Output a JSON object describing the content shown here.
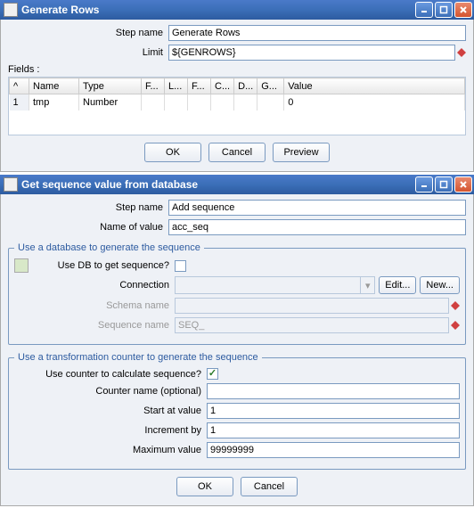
{
  "window1": {
    "title": "Generate Rows",
    "step_name_label": "Step name",
    "step_name_value": "Generate Rows",
    "limit_label": "Limit",
    "limit_value": "${GENROWS}",
    "fields_label": "Fields :",
    "columns": {
      "idx": "^",
      "name": "Name",
      "type": "Type",
      "f": "F...",
      "l": "L...",
      "fmt": "F...",
      "c": "C...",
      "d": "D...",
      "g": "G...",
      "value": "Value"
    },
    "row": {
      "idx": "1",
      "name": "tmp",
      "type": "Number",
      "value": "0"
    },
    "ok": "OK",
    "cancel": "Cancel",
    "preview": "Preview"
  },
  "window2": {
    "title": "Get sequence value from database",
    "step_name_label": "Step name",
    "step_name_value": "Add sequence",
    "name_of_value_label": "Name of value",
    "name_of_value_value": "acc_seq",
    "fs1_legend": "Use a database to generate the sequence",
    "use_db_label": "Use DB to get sequence?",
    "connection_label": "Connection",
    "edit": "Edit...",
    "new": "New...",
    "schema_label": "Schema name",
    "schema_value": "",
    "sequence_label": "Sequence name",
    "sequence_value": "SEQ_",
    "fs2_legend": "Use a transformation counter to generate the sequence",
    "use_counter_label": "Use counter to calculate sequence?",
    "counter_name_label": "Counter name (optional)",
    "counter_name_value": "",
    "start_label": "Start at value",
    "start_value": "1",
    "incr_label": "Increment by",
    "incr_value": "1",
    "max_label": "Maximum value",
    "max_value": "99999999",
    "ok": "OK",
    "cancel": "Cancel"
  }
}
